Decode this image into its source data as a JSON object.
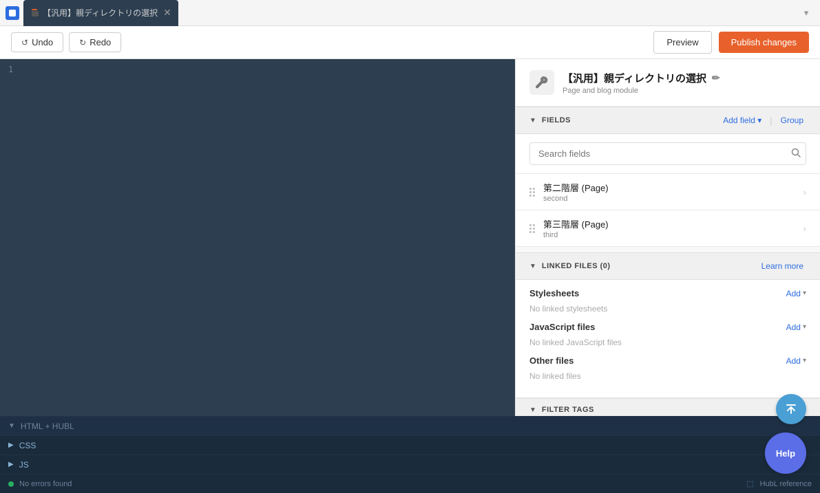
{
  "tabs": {
    "items": [
      {
        "label": "【汎用】親ディレクトリの選択",
        "active": true
      }
    ]
  },
  "toolbar": {
    "undo_label": "Undo",
    "redo_label": "Redo",
    "preview_label": "Preview",
    "publish_label": "Publish changes"
  },
  "editor": {
    "section_label": "HTML + HUBL",
    "css_label": "CSS",
    "js_label": "JS",
    "line_number": "1",
    "status": {
      "no_errors": "No errors found",
      "hubl_ref": "HubL reference"
    }
  },
  "panel": {
    "module_title": "【汎用】親ディレクトリの選択",
    "module_subtitle": "Page and blog module",
    "fields_section": "FIELDS",
    "add_field_label": "Add field",
    "group_label": "Group",
    "search_placeholder": "Search fields",
    "fields": [
      {
        "name": "第二階層 (Page)",
        "key": "second"
      },
      {
        "name": "第三階層 (Page)",
        "key": "third"
      }
    ],
    "linked_files_section": "LINKED FILES (0)",
    "learn_more_label": "Learn more",
    "stylesheets_label": "Stylesheets",
    "no_stylesheets": "No linked stylesheets",
    "add_label": "Add",
    "javascript_label": "JavaScript files",
    "no_javascript": "No linked JavaScript files",
    "other_label": "Other files",
    "no_other": "No linked files",
    "filter_tags_section": "FILTER TAGS"
  },
  "help": {
    "label": "Help"
  },
  "colors": {
    "publish_bg": "#e8612c",
    "help_bg": "#5b6ee8",
    "link_color": "#2d6cdf",
    "scroll_back_bg": "#4a9fd4"
  }
}
